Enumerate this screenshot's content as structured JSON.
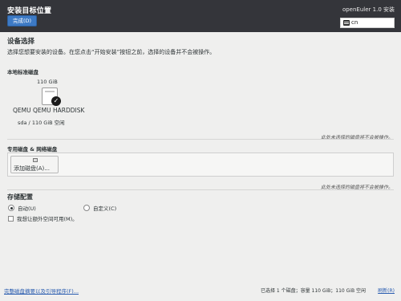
{
  "header": {
    "title": "安装目标位置",
    "done_label": "完成(D)",
    "product": "openEuler 1.0 安装",
    "keyboard_layout": "cn"
  },
  "device_selection": {
    "heading": "设备选择",
    "description": "选择您想要安装的设备。在您点击“开始安装”按钮之前，选择的设备并不会被操作。"
  },
  "local_disks": {
    "heading": "本地标准磁盘",
    "disks": [
      {
        "size": "110 GiB",
        "model": "QEMU QEMU HARDDISK",
        "info": "sda   /   110 GiB 空闲",
        "selected": true
      }
    ],
    "note": "此处未选择的磁盘将不会被操作。"
  },
  "special_disks": {
    "heading": "专用磁盘 & 网络磁盘",
    "add_button": "添加磁盘(A)...",
    "note": "此处未选择的磁盘将不会被操作。"
  },
  "storage_config": {
    "heading": "存储配置",
    "options": [
      {
        "label": "自动(U)",
        "selected": true
      },
      {
        "label": "自定义(C)",
        "selected": false
      }
    ],
    "extra_space_label": "我想让额外空间可用(M)。"
  },
  "footer": {
    "summary_link": "完整磁盘摘要以及引导程序(F)...",
    "status": "已选择 1 个磁盘；容量 110 GiB；110 GiB 空闲",
    "reset_link": "刷新(R)"
  }
}
